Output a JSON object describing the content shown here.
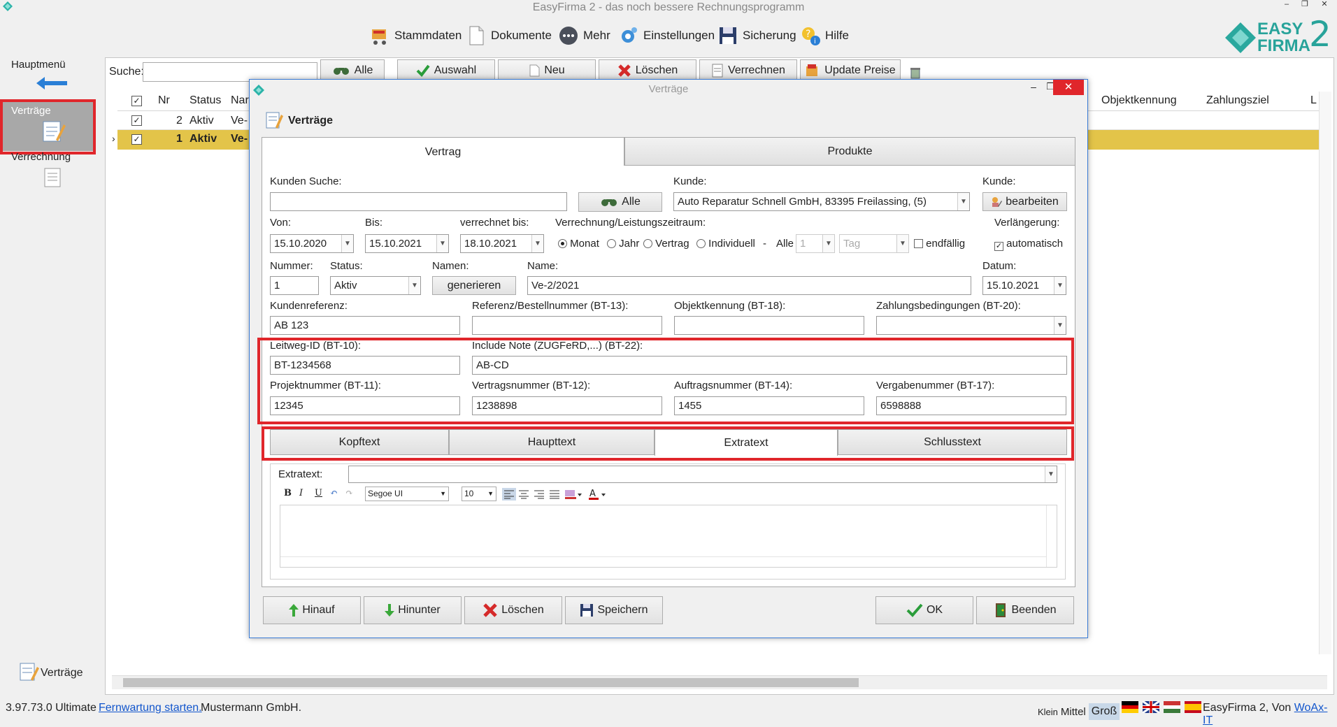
{
  "window": {
    "title": "EasyFirma 2 - das noch bessere Rechnungsprogramm",
    "min": "–",
    "max": "❐",
    "close": "✕"
  },
  "topmenu": [
    {
      "label": "Stammdaten"
    },
    {
      "label": "Dokumente"
    },
    {
      "label": "Mehr"
    },
    {
      "label": "Einstellungen"
    },
    {
      "label": "Sicherung"
    },
    {
      "label": "Hilfe"
    }
  ],
  "logo": {
    "line1": "EASY",
    "line2": "FIRMA",
    "digit": "2"
  },
  "sidebar": {
    "hauptmenu": "Hauptmenü",
    "items": [
      {
        "label": "Verträge"
      },
      {
        "label": "Verrechnung"
      }
    ],
    "bottom": "Verträge"
  },
  "toolbar": {
    "search_label": "Suche:",
    "search_value": "",
    "alle": "Alle",
    "auswahl": "Auswahl",
    "neu": "Neu",
    "loeschen": "Löschen",
    "verrechnen": "Verrechnen",
    "update": "Update Preise"
  },
  "grid": {
    "headers": {
      "check": "✓",
      "nr": "Nr",
      "status": "Status",
      "name": "Nar",
      "objekt": "Objektkennung",
      "zahlung": "Zahlungsziel",
      "last": "L"
    },
    "rows": [
      {
        "check": "✓",
        "nr": "2",
        "status": "Aktiv",
        "name": "Ve-"
      },
      {
        "check": "✓",
        "nr": "1",
        "status": "Aktiv",
        "name": "Ve-"
      }
    ],
    "row_marker": "›"
  },
  "statusbar": {
    "version": "3.97.73.0 Ultimate",
    "remote": "Fernwartung starten.",
    "company": "Mustermann GmbH.",
    "size_klein": "Klein",
    "size_mittel": "Mittel",
    "size_gross": "Groß",
    "footer_text": "EasyFirma 2, Von ",
    "footer_link": "WoAx-IT"
  },
  "dialog": {
    "title": "Verträge",
    "heading": "Verträge",
    "tabs": {
      "vertrag": "Vertrag",
      "produkte": "Produkte"
    },
    "kunden_suche": {
      "label": "Kunden Suche:",
      "value": ""
    },
    "alle_button": "Alle",
    "kunde": {
      "label": "Kunde:",
      "value": "Auto Reparatur Schnell GmbH, 83395 Freilassing, (5)"
    },
    "kunde_edit": {
      "label": "Kunde:",
      "button": "bearbeiten"
    },
    "von": {
      "label": "Von:",
      "value": "15.10.2020"
    },
    "bis": {
      "label": "Bis:",
      "value": "15.10.2021"
    },
    "verrechnet": {
      "label": "verrechnet bis:",
      "value": "18.10.2021"
    },
    "zeitraum": {
      "label": "Verrechnung/Leistungszeitraum:",
      "options": [
        "Monat",
        "Jahr",
        "Vertrag",
        "Individuell"
      ],
      "selected": "Monat",
      "dash": "-",
      "alle_label": "Alle",
      "alle_value": "1",
      "unit_value": "Tag",
      "endfaellig": "endfällig"
    },
    "verlaengerung": {
      "label": "Verlängerung:",
      "checkbox": "automatisch",
      "checked": true
    },
    "nummer": {
      "label": "Nummer:",
      "value": "1"
    },
    "status": {
      "label": "Status:",
      "value": "Aktiv"
    },
    "namen": {
      "label": "Namen:",
      "button": "generieren"
    },
    "name": {
      "label": "Name:",
      "value": "Ve-2/2021"
    },
    "datum": {
      "label": "Datum:",
      "value": "15.10.2021"
    },
    "kundenreferenz": {
      "label": "Kundenreferenz:",
      "value": "AB 123"
    },
    "referenz": {
      "label": "Referenz/Bestellnummer (BT-13):",
      "value": ""
    },
    "objektkennung": {
      "label": "Objektkennung (BT-18):",
      "value": ""
    },
    "zahlungsbed": {
      "label": "Zahlungsbedingungen (BT-20):",
      "value": ""
    },
    "leitweg": {
      "label": "Leitweg-ID (BT-10):",
      "value": "BT-1234568"
    },
    "include_note": {
      "label": "Include Note (ZUGFeRD,...) (BT-22):",
      "value": "AB-CD"
    },
    "projektnummer": {
      "label": "Projektnummer (BT-11):",
      "value": "12345"
    },
    "vertragsnummer": {
      "label": "Vertragsnummer (BT-12):",
      "value": "1238898"
    },
    "auftragsnummer": {
      "label": "Auftragsnummer (BT-14):",
      "value": "1455"
    },
    "vergabenummer": {
      "label": "Vergabenummer (BT-17):",
      "value": "6598888"
    },
    "subtabs": [
      "Kopftext",
      "Haupttext",
      "Extratext",
      "Schlusstext"
    ],
    "extratext": {
      "label": "Extratext:",
      "value": ""
    },
    "editor": {
      "font": "Segoe UI",
      "size": "10"
    },
    "buttons": {
      "hinauf": "Hinauf",
      "hinunter": "Hinunter",
      "loeschen": "Löschen",
      "speichern": "Speichern",
      "ok": "OK",
      "beenden": "Beenden"
    }
  },
  "colors": {
    "accent_red": "#e0262b",
    "selected_row": "#e3c449",
    "brand_teal": "#28a39a",
    "dialog_border": "#3a7bd5"
  }
}
